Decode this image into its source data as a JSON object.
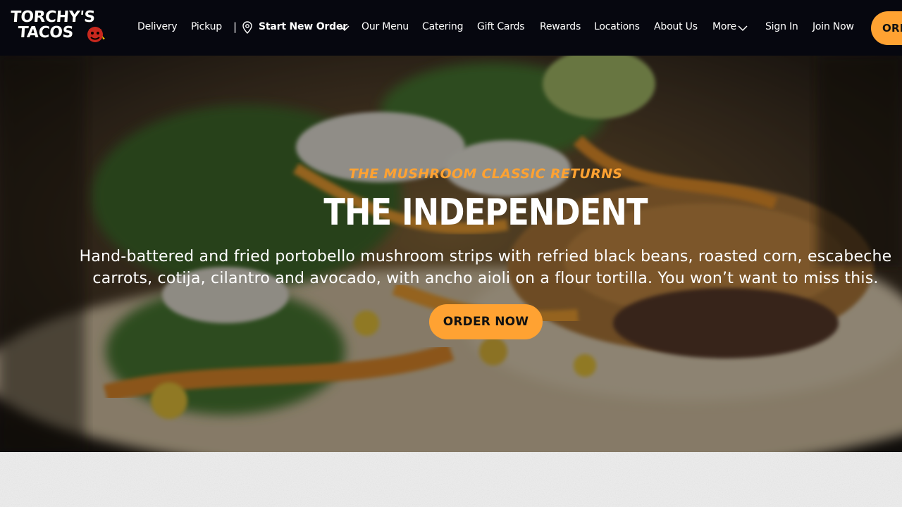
{
  "brand": {
    "logo_line1": "TORCHY'S",
    "logo_line2": "TACOS",
    "accent": "#ffa232",
    "nav_bg": "#06070f"
  },
  "nav": {
    "delivery": "Delivery",
    "pickup": "Pickup",
    "separator": "|",
    "start_new_order": "Start New Order",
    "our_menu": "Our Menu",
    "catering": "Catering",
    "gift_cards": "Gift Cards",
    "rewards": "Rewards",
    "locations": "Locations",
    "about_us": "About Us",
    "more": "More",
    "sign_in": "Sign In",
    "join_now": "Join Now",
    "order_button": "ORDER NOW"
  },
  "hero": {
    "eyebrow": "THE MUSHROOM CLASSIC RETURNS",
    "title": "THE INDEPENDENT",
    "description": "Hand-battered and fried portobello mushroom strips with refried black beans, roasted corn, escabeche carrots, cotija, cilantro and avocado, with ancho aioli on a flour tortilla. You won’t want to miss this.",
    "cta": "ORDER NOW"
  },
  "icons": {
    "pin": "location-pin-icon",
    "chevron": "chevron-down-icon",
    "devil": "devil-mascot-icon"
  }
}
